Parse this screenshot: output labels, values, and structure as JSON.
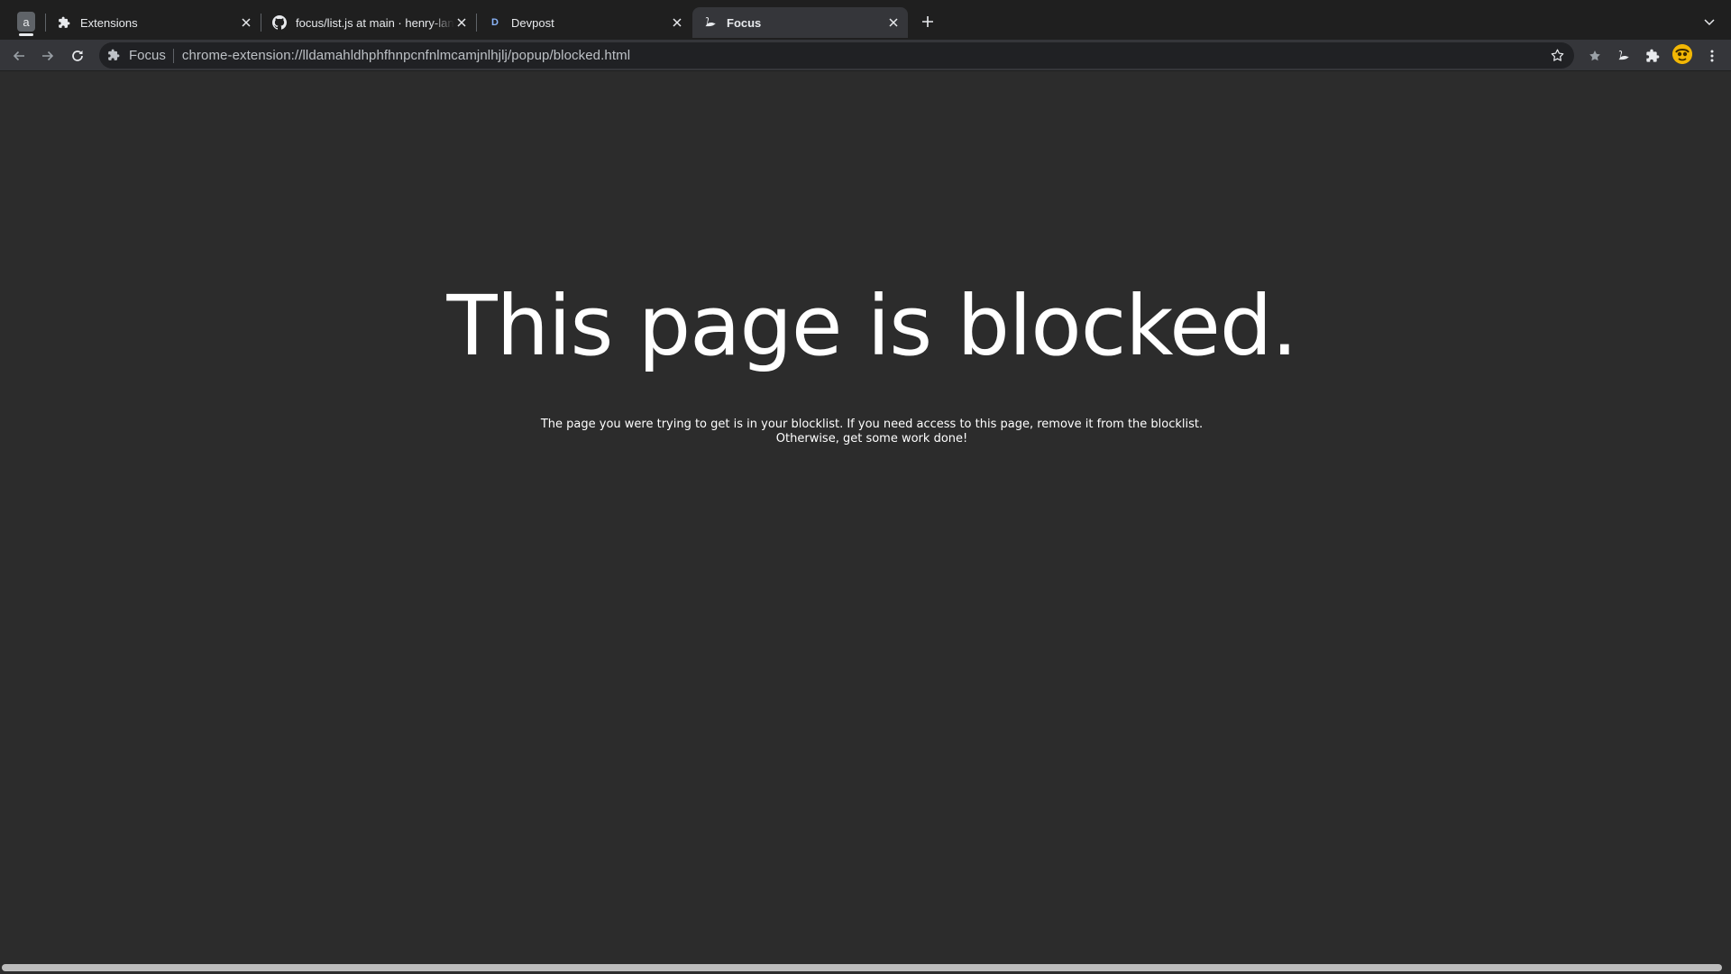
{
  "tabs": [
    {
      "title": "Extensions",
      "icon": "puzzle-icon",
      "active": false
    },
    {
      "title": "focus/list.js at main · henry-lan",
      "icon": "github-icon",
      "active": false
    },
    {
      "title": "Devpost",
      "icon": "devpost-icon",
      "active": false
    },
    {
      "title": "Focus",
      "icon": "focus-swan-icon",
      "active": true
    }
  ],
  "tab_search_label": "a",
  "devpost_favicon_letter": "D",
  "omnibox": {
    "chip_label": "Focus",
    "url": "chrome-extension://lldamahldhphfhnpcnfnlmcamjnlhjlj/popup/blocked.html"
  },
  "page": {
    "headline": "This page is blocked.",
    "message_line1": "The page you were trying to get is in your blocklist. If you need access to this page, remove it from the blocklist.",
    "message_line2": "Otherwise, get some work done!"
  },
  "colors": {
    "tabstrip_bg": "#1f1f1f",
    "toolbar_bg": "#35363a",
    "page_bg": "#2c2c2c",
    "text": "#ffffff",
    "avatar": "#f2b705"
  }
}
